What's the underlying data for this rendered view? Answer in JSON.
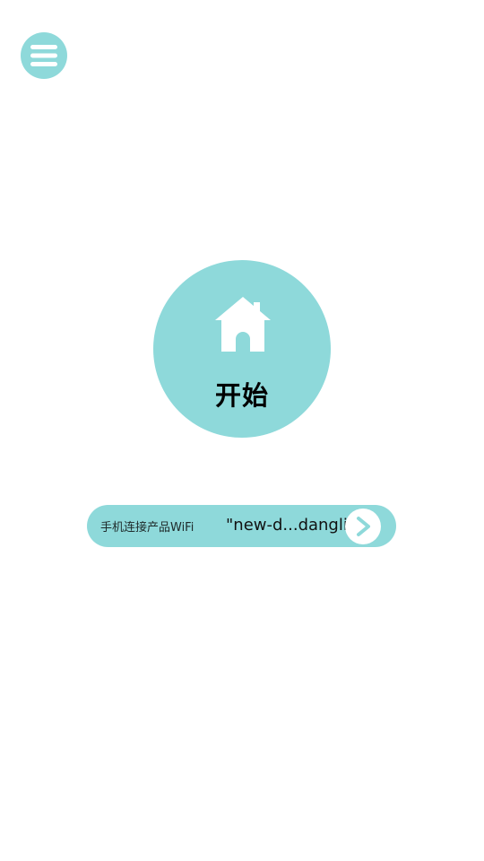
{
  "theme": {
    "accent": "#8ed9da",
    "icon_color": "#ffffff",
    "text_color": "#000000"
  },
  "menu": {
    "icon": "hamburger-menu-icon"
  },
  "start": {
    "icon": "home-icon",
    "label": "开始"
  },
  "wifi": {
    "label": "手机连接产品WiFi",
    "network_name": "\"new-d...dangli\"",
    "arrow_icon": "chevron-right-icon"
  }
}
